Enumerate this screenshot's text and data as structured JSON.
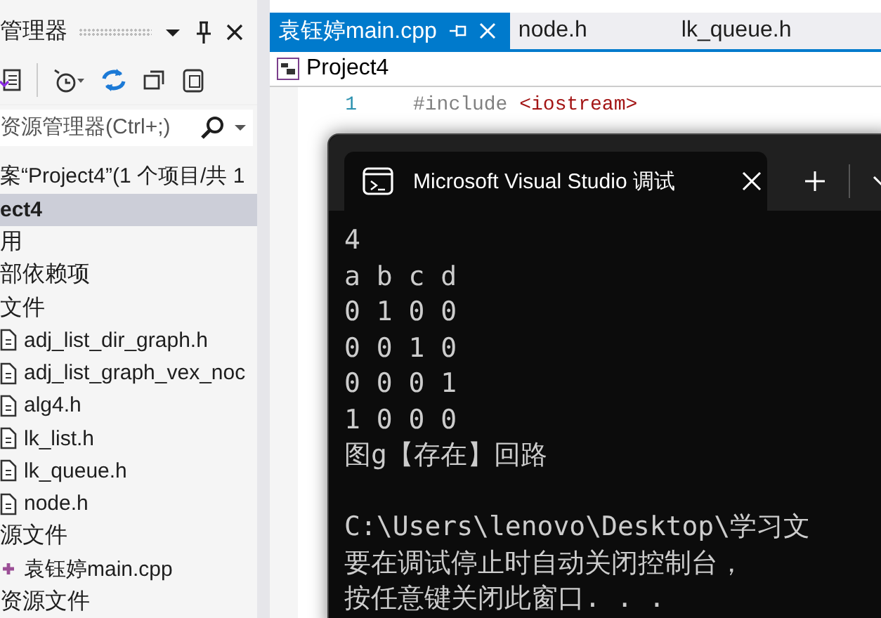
{
  "solution_explorer": {
    "title": "管理器",
    "search": {
      "placeholder": "资源管理器(Ctrl+;)"
    },
    "solution_row": "案“Project4”(1 个项目/共 1",
    "tree": [
      {
        "label": "ect4",
        "kind": "project",
        "selected": true,
        "children": [
          {
            "label": "用",
            "kind": "folder",
            "selected": false
          },
          {
            "label": "部依赖项",
            "kind": "folder",
            "selected": false
          },
          {
            "label": "文件",
            "kind": "folder",
            "selected": false,
            "children": [
              {
                "label": "adj_list_dir_graph.h",
                "kind": "header",
                "selected": false
              },
              {
                "label": "adj_list_graph_vex_noc",
                "kind": "header",
                "selected": false
              },
              {
                "label": "alg4.h",
                "kind": "header",
                "selected": false
              },
              {
                "label": "lk_list.h",
                "kind": "header",
                "selected": false
              },
              {
                "label": "lk_queue.h",
                "kind": "header",
                "selected": false
              },
              {
                "label": "node.h",
                "kind": "header",
                "selected": false
              }
            ]
          },
          {
            "label": "源文件",
            "kind": "folder",
            "selected": false,
            "children": [
              {
                "label": "袁钰婷main.cpp",
                "kind": "source",
                "selected": false
              }
            ]
          },
          {
            "label": "资源文件",
            "kind": "folder",
            "selected": false
          }
        ]
      }
    ]
  },
  "editor": {
    "tabs": [
      {
        "label": "袁钰婷main.cpp",
        "selected": true
      },
      {
        "label": "node.h",
        "selected": false
      },
      {
        "label": "lk_queue.h",
        "selected": false
      }
    ],
    "project_bar": "Project4",
    "code_lines": [
      {
        "number": "1",
        "directive": "#include",
        "header": "<iostream>"
      }
    ]
  },
  "terminal": {
    "tab_title": "Microsoft Visual Studio 调试",
    "output": [
      "4",
      "a b c d",
      "0 1 0 0",
      "0 0 1 0",
      "0 0 0 1",
      "1 0 0 0",
      "图g【存在】回路"
    ],
    "footer": [
      "C:\\Users\\lenovo\\Desktop\\学习文",
      "要在调试停止时自动关闭控制台，",
      "按任意键关闭此窗口. . ."
    ]
  }
}
